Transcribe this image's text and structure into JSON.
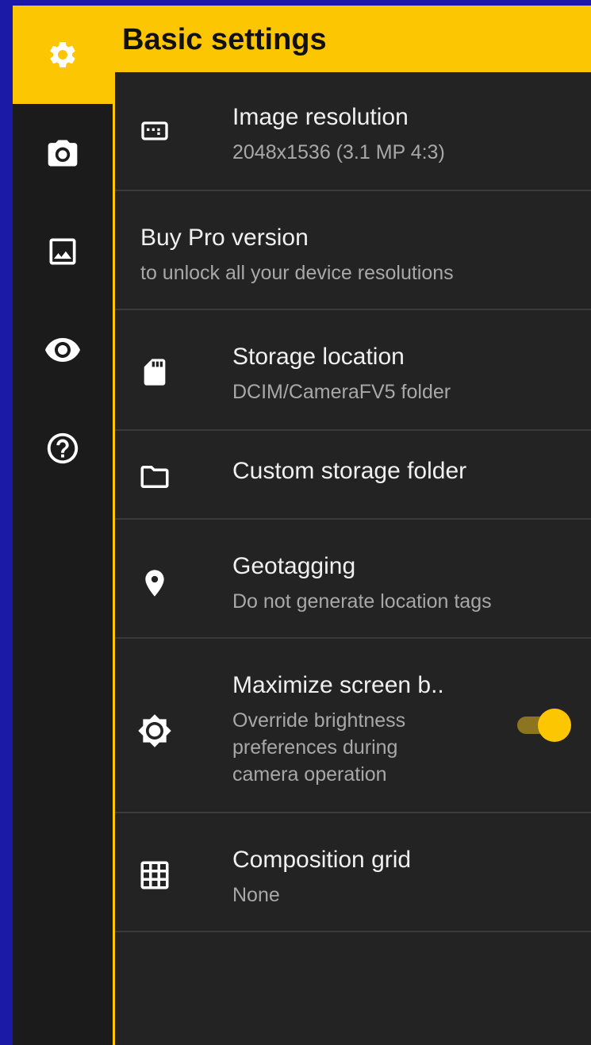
{
  "header": {
    "title": "Basic settings"
  },
  "sidebar": {
    "items": [
      {
        "icon": "gear-icon",
        "active": true
      },
      {
        "icon": "camera-icon",
        "active": false
      },
      {
        "icon": "image-icon",
        "active": false
      },
      {
        "icon": "eye-icon",
        "active": false
      },
      {
        "icon": "help-icon",
        "active": false
      }
    ]
  },
  "settings": {
    "image_resolution": {
      "icon": "resolution-icon",
      "title": "Image resolution",
      "subtitle": "2048x1536 (3.1 MP 4:3)"
    },
    "buy_pro": {
      "title": "Buy Pro version",
      "subtitle": "to unlock all your device resolutions"
    },
    "storage_location": {
      "icon": "sd-card-icon",
      "title": "Storage location",
      "subtitle": "DCIM/CameraFV5 folder"
    },
    "custom_storage": {
      "icon": "folder-icon",
      "title": "Custom storage folder"
    },
    "geotagging": {
      "icon": "location-pin-icon",
      "title": "Geotagging",
      "subtitle": "Do not generate location tags"
    },
    "max_brightness": {
      "icon": "brightness-icon",
      "title": "Maximize screen b..",
      "subtitle_lines": [
        "Override brightness",
        "preferences during",
        "camera operation"
      ],
      "enabled": true
    },
    "composition_grid": {
      "icon": "grid-icon",
      "title": "Composition grid",
      "subtitle": "None"
    }
  },
  "colors": {
    "accent": "#fcc602",
    "content_bg": "#232323",
    "sidebar_bg": "#1b1b1b",
    "frame_bg": "#1a1aa6"
  }
}
